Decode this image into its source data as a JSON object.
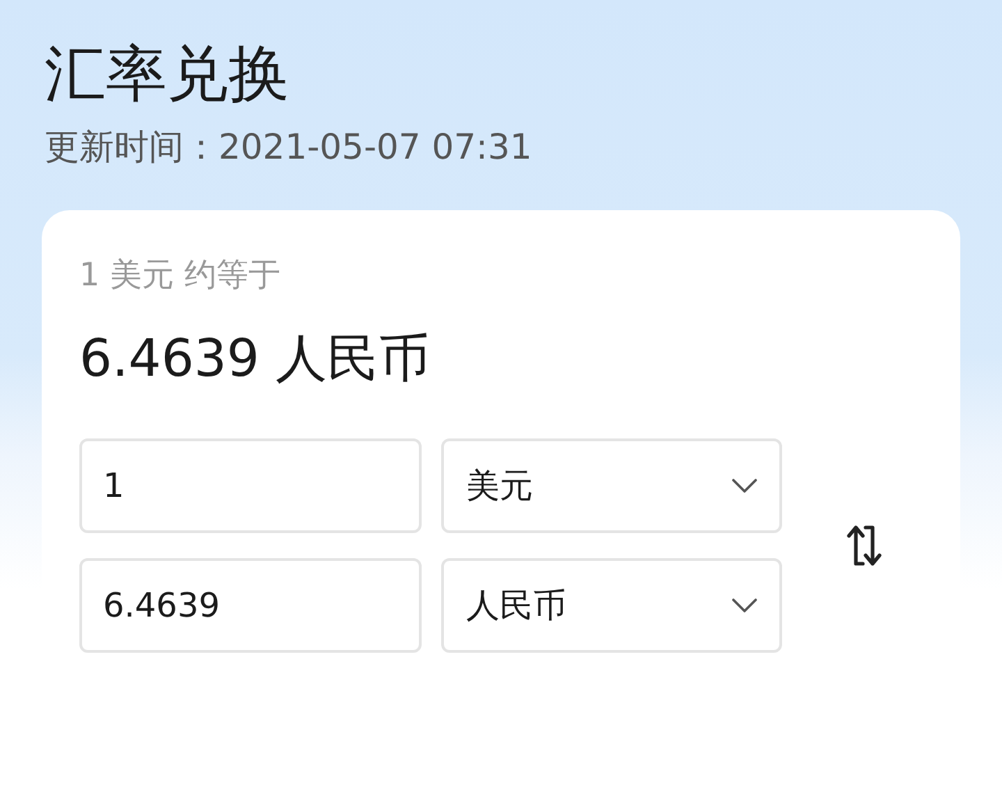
{
  "header": {
    "title": "汇率兑换",
    "updated": "更新时间：2021-05-07 07:31"
  },
  "converter": {
    "summary": "1 美元 约等于",
    "result": "6.4639 人民币",
    "rows": [
      {
        "amount": "1",
        "currency": "美元"
      },
      {
        "amount": "6.4639",
        "currency": "人民币"
      }
    ]
  }
}
